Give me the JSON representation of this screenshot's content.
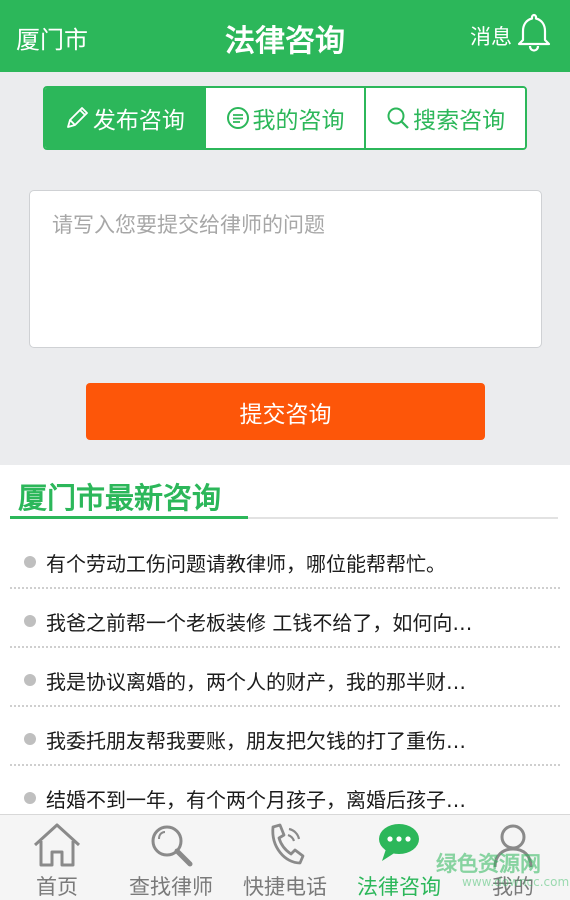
{
  "header": {
    "city": "厦门市",
    "title": "法律咨询",
    "messages_label": "消息"
  },
  "tabs": [
    {
      "label": "发布咨询",
      "icon": "pencil-icon",
      "active": true
    },
    {
      "label": "我的咨询",
      "icon": "chat-bubble-icon",
      "active": false
    },
    {
      "label": "搜索咨询",
      "icon": "search-icon",
      "active": false
    }
  ],
  "question": {
    "placeholder": "请写入您要提交给律师的问题",
    "value": ""
  },
  "submit_label": "提交咨询",
  "section_title": "厦门市最新咨询",
  "consultations": [
    "有个劳动工伤问题请教律师，哪位能帮帮忙。",
    "我爸之前帮一个老板装修 工钱不给了，如何向…",
    "我是协议离婚的，两个人的财产，我的那半财…",
    "我委托朋友帮我要账，朋友把欠钱的打了重伤…",
    "结婚不到一年，有个两个月孩子，离婚后孩子…"
  ],
  "bottom_nav": [
    {
      "label": "首页",
      "icon": "home-icon",
      "active": false
    },
    {
      "label": "查找律师",
      "icon": "search-icon",
      "active": false
    },
    {
      "label": "快捷电话",
      "icon": "phone-icon",
      "active": false
    },
    {
      "label": "法律咨询",
      "icon": "chat-icon",
      "active": true
    },
    {
      "label": "我的",
      "icon": "user-icon",
      "active": false
    }
  ],
  "watermark": {
    "text": "绿色资源网",
    "sub": "www.downcc.com"
  },
  "colors": {
    "brand_green": "#2cb75a",
    "submit_orange": "#fd5609",
    "background_gray": "#ebecee"
  }
}
